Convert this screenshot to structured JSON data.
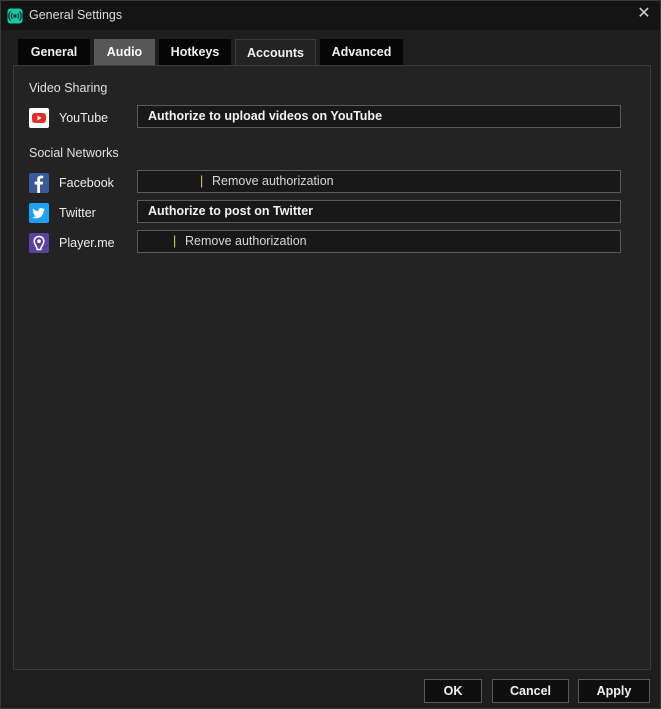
{
  "window": {
    "title": "General Settings",
    "close_glyph": "✕"
  },
  "tabs": [
    {
      "label": "General"
    },
    {
      "label": "Audio",
      "state": "hover"
    },
    {
      "label": "Hotkeys"
    },
    {
      "label": "Accounts",
      "state": "active"
    },
    {
      "label": "Advanced"
    }
  ],
  "video_sharing": {
    "title": "Video Sharing",
    "youtube": {
      "label": "YouTube",
      "icon": "youtube-icon",
      "action": "Authorize to upload videos on YouTube"
    }
  },
  "social_networks": {
    "title": "Social Networks",
    "facebook": {
      "label": "Facebook",
      "icon": "facebook-icon",
      "separator": "|",
      "action": "Remove authorization"
    },
    "twitter": {
      "label": "Twitter",
      "icon": "twitter-icon",
      "action": "Authorize to post on Twitter"
    },
    "playerme": {
      "label": "Player.me",
      "icon": "playerme-icon",
      "separator": "|",
      "action": "Remove authorization"
    }
  },
  "buttons": {
    "ok": "OK",
    "cancel": "Cancel",
    "apply": "Apply"
  },
  "colors": {
    "youtube": "#e52d27",
    "facebook": "#3b5998",
    "twitter": "#1da1f2",
    "playerme": "#5f3f9e",
    "app_icon": "#19c7a8",
    "separator": "#e8c85a"
  }
}
